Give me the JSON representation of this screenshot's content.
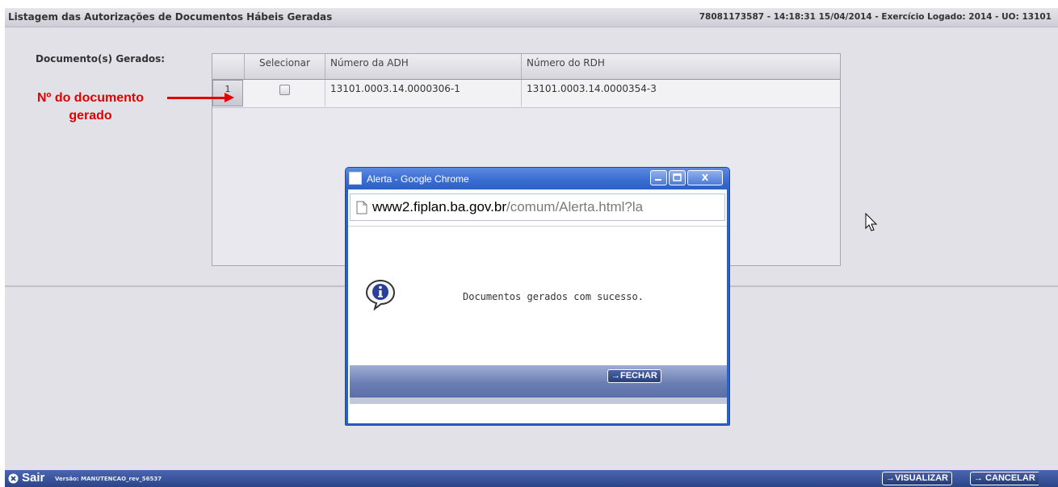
{
  "page": {
    "title": "Listagem das Autorizações de Documentos Hábeis Geradas",
    "session_info": "78081173587 - 14:18:31 15/04/2014 - Exercício Logado: 2014 - UO: 13101"
  },
  "form": {
    "label": "Documento(s) Gerados:"
  },
  "table": {
    "columns": [
      "",
      "Selecionar",
      "Número da ADH",
      "Número do RDH"
    ],
    "rows": [
      {
        "num": "1",
        "selected": false,
        "adh": "13101.0003.14.0000306-1",
        "rdh": "13101.0003.14.0000354-3"
      }
    ]
  },
  "annotation": {
    "line1": "Nº do documento",
    "line2": "gerado",
    "color": "#e00000"
  },
  "dialog": {
    "title": "Alerta - Google Chrome",
    "minimize_icon": "minimize-icon",
    "maximize_icon": "maximize-icon",
    "close_glyph": "X",
    "url_host": "www2.fiplan.ba.gov.br",
    "url_path": "/comum/Alerta.html?la",
    "message": "Documentos gerados com sucesso.",
    "close_button": "→FECHAR"
  },
  "footer": {
    "exit_label": "Sair",
    "version": "Versão: MANUTENCAO_rev_56537",
    "visualize_button": "→VISUALIZAR",
    "cancel_button": "→ CANCELAR"
  },
  "colors": {
    "app_background": "#e3e1e8",
    "bar_blue": "#2c4589",
    "dialog_frame": "#2a61c4"
  }
}
